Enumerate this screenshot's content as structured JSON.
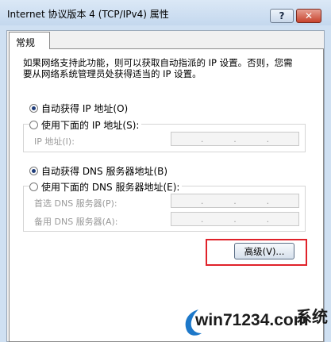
{
  "window": {
    "title": "Internet 协议版本 4 (TCP/IPv4) 属性",
    "help_label": "?",
    "close_label": "✕"
  },
  "tabs": [
    {
      "label": "常规"
    }
  ],
  "intro_text": "如果网络支持此功能，则可以获取自动指派的 IP 设置。否则，您需要从网络系统管理员处获得适当的 IP 设置。",
  "ip": {
    "auto_label": "自动获得 IP 地址(O)",
    "manual_label": "使用下面的 IP 地址(S):",
    "address_label": "IP 地址(I):",
    "selected": "auto"
  },
  "dns": {
    "auto_label": "自动获得 DNS 服务器地址(B)",
    "manual_label": "使用下面的 DNS 服务器地址(E):",
    "preferred_label": "首选 DNS 服务器(P):",
    "alternate_label": "备用 DNS 服务器(A):",
    "selected": "auto"
  },
  "advanced_button": "高级(V)...",
  "watermark": {
    "site": "win71234.com",
    "logo_text": "系统"
  },
  "colors": {
    "highlight": "#e0222a",
    "titlebar": "#cfe0f2"
  }
}
